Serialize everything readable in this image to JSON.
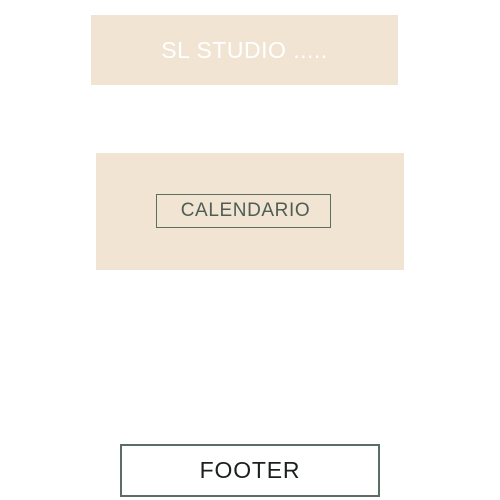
{
  "header": {
    "title": "SL STUDIO ....."
  },
  "hero": {
    "calendar_label": "CALENDARIO"
  },
  "footer": {
    "label": "FOOTER"
  },
  "colors": {
    "panel_background": "#f1e4d2",
    "border": "#5b6e63",
    "header_text": "#ffffff",
    "footer_text": "#1b1f1d"
  }
}
